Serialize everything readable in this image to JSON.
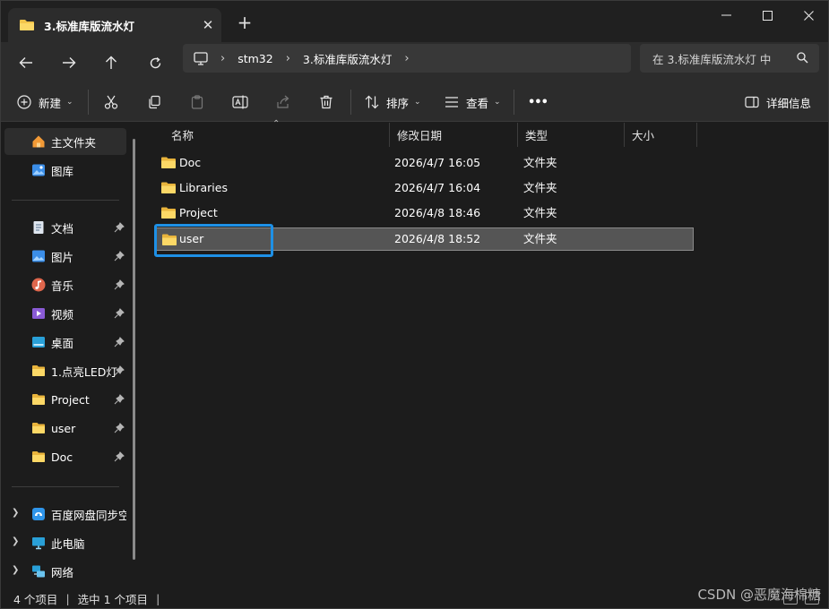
{
  "window": {
    "tab_title": "3.标准库版流水灯",
    "new_tab": "+",
    "close_tab": "✕",
    "minimize": "—",
    "close": "✕"
  },
  "address": {
    "crumbs": [
      "stm32",
      "3.标准库版流水灯"
    ],
    "search_placeholder": "在 3.标准库版流水灯 中"
  },
  "commands": {
    "new_label": "新建",
    "sort_label": "排序",
    "view_label": "查看",
    "more_label": "•••",
    "details_label": "详细信息"
  },
  "sidebar": {
    "top": [
      {
        "label": "主文件夹",
        "icon": "home-icon"
      },
      {
        "label": "图库",
        "icon": "gallery-icon"
      }
    ],
    "quick": [
      {
        "label": "文档",
        "icon": "documents-icon"
      },
      {
        "label": "图片",
        "icon": "pictures-icon"
      },
      {
        "label": "音乐",
        "icon": "music-icon"
      },
      {
        "label": "视频",
        "icon": "videos-icon"
      },
      {
        "label": "桌面",
        "icon": "desktop-icon"
      },
      {
        "label": "1.点亮LED灯",
        "icon": "folder-icon"
      },
      {
        "label": "Project",
        "icon": "folder-icon"
      },
      {
        "label": "user",
        "icon": "folder-icon"
      },
      {
        "label": "Doc",
        "icon": "folder-icon"
      }
    ],
    "bottom": [
      {
        "label": "百度网盘同步空",
        "icon": "baidu-netdisk-icon"
      },
      {
        "label": "此电脑",
        "icon": "this-pc-icon"
      },
      {
        "label": "网络",
        "icon": "network-icon"
      }
    ]
  },
  "columns": [
    "名称",
    "修改日期",
    "类型",
    "大小"
  ],
  "files": [
    {
      "name": "Doc",
      "date": "2026/4/7 16:05",
      "type": "文件夹",
      "size": ""
    },
    {
      "name": "Libraries",
      "date": "2026/4/7 16:04",
      "type": "文件夹",
      "size": ""
    },
    {
      "name": "Project",
      "date": "2026/4/8 18:46",
      "type": "文件夹",
      "size": ""
    },
    {
      "name": "user",
      "date": "2026/4/8 18:52",
      "type": "文件夹",
      "size": ""
    }
  ],
  "status": {
    "count": "4 个项目",
    "selected": "选中 1 个项目",
    "sep": "|"
  },
  "watermark": "CSDN @恶魔海棉糖",
  "colors": {
    "accent": "#1e90e6",
    "folder": "#f3c54b",
    "background": "#1c1c1c"
  }
}
